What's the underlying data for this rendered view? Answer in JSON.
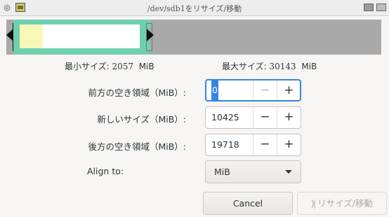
{
  "window": {
    "title": "/dev/sdb1をリサイズ/移動",
    "app_icon": "debian-swirl-icon",
    "second_icon": "image-icon"
  },
  "graphic": {
    "colors": {
      "partition_border": "#6fd0b0",
      "used": "#f7f7b8",
      "unallocated": "#a9a9a9"
    },
    "used_fraction": 0.19
  },
  "limits": {
    "min_label": "最小サイズ:",
    "min_value": "2057",
    "min_unit": "MiB",
    "max_label": "最大サイズ:",
    "max_value": "30143",
    "max_unit": "MiB"
  },
  "fields": {
    "free_before": {
      "label": "前方の空き領域（MiB）:",
      "value": "0",
      "minus": "−",
      "plus": "+"
    },
    "new_size": {
      "label": "新しいサイズ（MiB）:",
      "value": "10425",
      "minus": "−",
      "plus": "+"
    },
    "free_after": {
      "label": "後方の空き領域（MiB）:",
      "value": "19718",
      "minus": "−",
      "plus": "+"
    },
    "align": {
      "label": "Align to:",
      "value": "MiB"
    }
  },
  "buttons": {
    "cancel": "Cancel",
    "resize": "リサイズ/移動",
    "resize_icon": "resize-move-icon"
  },
  "accent_color": "#3584e4"
}
